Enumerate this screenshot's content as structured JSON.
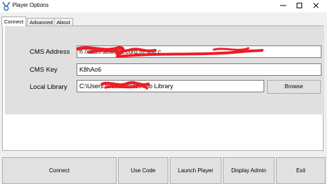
{
  "window": {
    "title": "Player Options",
    "icons": [
      "app-icon",
      "minimize-icon",
      "maximize-icon",
      "close-icon"
    ]
  },
  "tabs": [
    {
      "label": "Connect",
      "active": true
    },
    {
      "label": "Advanced",
      "active": false
    },
    {
      "label": "About",
      "active": false
    }
  ],
  "connect": {
    "cms_address_label": "CMS Address",
    "cms_address_value": "h            /xibo.l      selfhost.corp.m         soft.c",
    "cms_key_label": "CMS Key",
    "cms_key_value": "K8hAo6",
    "local_library_label": "Local Library",
    "local_library_value": "C:\\Users                          \\Documents\\Xibo Library",
    "browse_label": "Browse"
  },
  "buttons": {
    "connect": "Connect",
    "use_code": "Use Code",
    "launch_player": "Launch Player",
    "display_admin": "Display Admin",
    "exit": "Exit"
  },
  "colors": {
    "redaction": "#ee1c24",
    "panel_gray": "#e0e0e0",
    "button_face": "#e1e1e1"
  }
}
